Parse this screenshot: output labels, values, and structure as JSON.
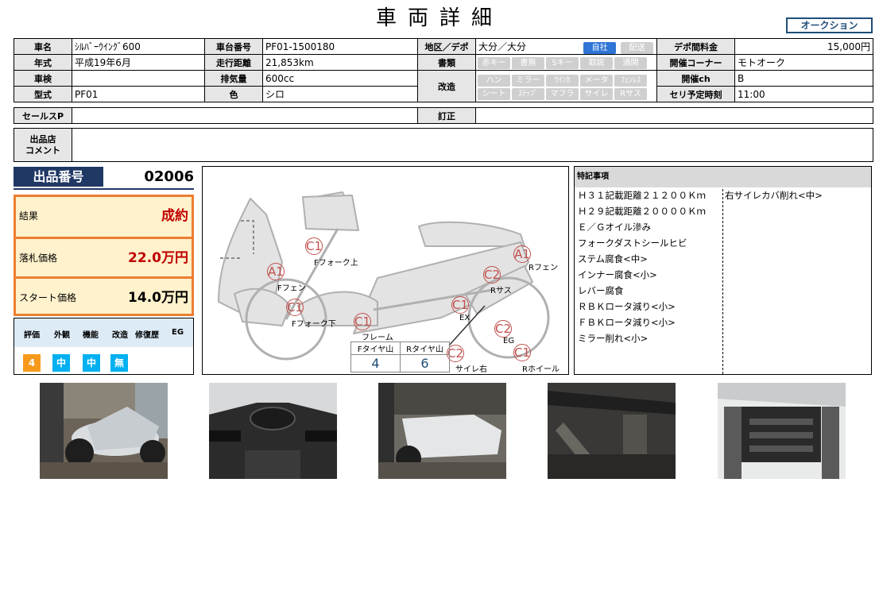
{
  "header": {
    "title": "車両詳細",
    "auction_badge": "オークション"
  },
  "spec": {
    "row1": {
      "name_label": "車名",
      "name_value": "ｼﾙﾊﾞｰｳｲﾝｸﾞ600",
      "frame_label": "車台番号",
      "frame_value": "PF01-1500180",
      "area_label": "地区／デポ",
      "area_value": "大分／大分",
      "area_chip_on": "自社",
      "area_chip_off": "配送",
      "fee_label": "デポ間料金",
      "fee_value": "15,000円"
    },
    "row2": {
      "year_label": "年式",
      "year_value": "平成19年6月",
      "mileage_label": "走行距離",
      "mileage_value": "21,853km",
      "docs_label": "書類",
      "docs_chips": [
        "赤キー",
        "書無",
        "Sキー",
        "取説",
        "通関"
      ],
      "corner_label": "開催コーナー",
      "corner_value": "モトオーク"
    },
    "row3": {
      "inspection_label": "車検",
      "inspection_value": "",
      "displacement_label": "排気量",
      "displacement_value": "600cc",
      "mod_label": "改造",
      "mod_chips_row1": [
        "ハン",
        "ミラー",
        "ｳｲﾝｶ",
        "メータ",
        "ﾌｪﾝﾚｽ"
      ],
      "mod_chips_row2": [
        "シート",
        "ｽﾃｯﾌﾟ",
        "マフラ",
        "サイレ",
        "Rサス"
      ],
      "channel_label": "開催ch",
      "channel_value": "B"
    },
    "row4": {
      "model_label": "型式",
      "model_value": "PF01",
      "color_label": "色",
      "color_value": "シロ",
      "time_label": "セリ予定時刻",
      "time_value": "11:00"
    },
    "sales_label": "セールスP",
    "sales_value": "",
    "correction_label": "訂正",
    "correction_value": "",
    "store_label": "出品店\nコメント",
    "store_value": ""
  },
  "lot": {
    "label": "出品番号",
    "number": "02006"
  },
  "results": [
    {
      "label": "結果",
      "value": "成約",
      "color": "#c00000"
    },
    {
      "label": "落札価格",
      "value": "22.0万円",
      "color": "#c00000"
    },
    {
      "label": "スタート価格",
      "value": "14.0万円",
      "color": "#000000"
    }
  ],
  "grades": {
    "headers": [
      "評価",
      "外観",
      "機能",
      "改造",
      "修復歴",
      "EG"
    ],
    "chips": [
      {
        "value": "4",
        "color": "#f79a1c"
      },
      {
        "value": "中",
        "color": "#00b0f0"
      },
      {
        "value": "中",
        "color": "#00b0f0"
      },
      {
        "value": "無",
        "color": "#00b0f0"
      }
    ]
  },
  "diagram": {
    "marks": [
      {
        "code": "C1",
        "label": "Fフォーク上"
      },
      {
        "code": "A1",
        "label": "Fフェン"
      },
      {
        "code": "C1",
        "label": "Fフォーク下"
      },
      {
        "code": "C1",
        "label": "フレーム"
      },
      {
        "code": "A1",
        "label": "Rフェン"
      },
      {
        "code": "C2",
        "label": "Rサス"
      },
      {
        "code": "C1",
        "label": "EX"
      },
      {
        "code": "C2",
        "label": "EG"
      },
      {
        "code": "C2",
        "label": "サイレ右"
      },
      {
        "code": "C1",
        "label": "Rホイール"
      }
    ],
    "tire": {
      "front_label": "Fタイヤ山",
      "rear_label": "Rタイヤ山",
      "front_value": "4",
      "rear_value": "6"
    }
  },
  "notes": {
    "title": "特記事項",
    "left": [
      "Ｈ３１記載距離２１２００Ｋｍ",
      "Ｈ２９記載距離２００００Ｋｍ",
      "Ｅ／Ｇオイル滲み",
      "フォークダストシールヒビ",
      "ステム腐食<中>",
      "インナー腐食<小>",
      "レバー腐食",
      "ＲＢＫロータ減り<小>",
      "ＦＢＫロータ減り<小>",
      "ミラー削れ<小>"
    ],
    "right": [
      "右サイレカバ削れ<中>"
    ]
  }
}
